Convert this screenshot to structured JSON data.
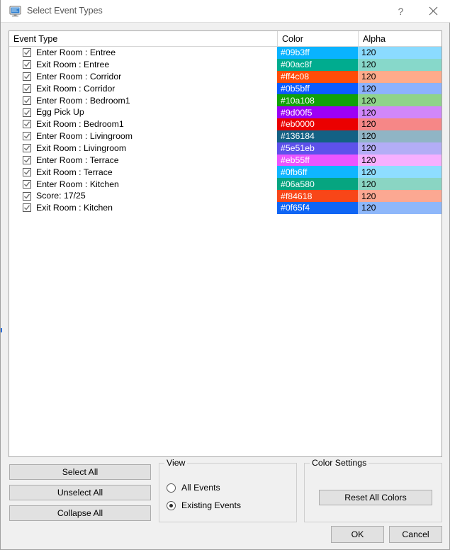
{
  "window": {
    "title": "Select Event Types",
    "icon": "monitor-icon",
    "help_label": "?",
    "close_label": "×"
  },
  "list": {
    "columns": [
      "Event Type",
      "Color",
      "Alpha"
    ],
    "rows": [
      {
        "label": "Enter Room : Entree",
        "checked": true,
        "color": "#09b3ff",
        "alpha": "120"
      },
      {
        "label": "Exit Room : Entree",
        "checked": true,
        "color": "#00ac8f",
        "alpha": "120"
      },
      {
        "label": "Enter Room : Corridor",
        "checked": true,
        "color": "#ff4c08",
        "alpha": "120"
      },
      {
        "label": "Exit Room : Corridor",
        "checked": true,
        "color": "#0b5bff",
        "alpha": "120"
      },
      {
        "label": "Enter Room : Bedroom1",
        "checked": true,
        "color": "#10a108",
        "alpha": "120"
      },
      {
        "label": "Egg Pick Up",
        "checked": true,
        "color": "#9d00f5",
        "alpha": "120"
      },
      {
        "label": "Exit Room : Bedroom1",
        "checked": true,
        "color": "#eb0000",
        "alpha": "120"
      },
      {
        "label": "Enter Room : Livingroom",
        "checked": true,
        "color": "#136184",
        "alpha": "120"
      },
      {
        "label": "Exit Room : Livingroom",
        "checked": true,
        "color": "#5e51eb",
        "alpha": "120"
      },
      {
        "label": "Enter Room : Terrace",
        "checked": true,
        "color": "#eb55ff",
        "alpha": "120"
      },
      {
        "label": "Exit Room : Terrace",
        "checked": true,
        "color": "#0fb6ff",
        "alpha": "120"
      },
      {
        "label": "Enter Room : Kitchen",
        "checked": true,
        "color": "#06a580",
        "alpha": "120"
      },
      {
        "label": "Score: 17/25",
        "checked": true,
        "color": "#f84618",
        "alpha": "120"
      },
      {
        "label": "Exit Room : Kitchen",
        "checked": true,
        "color": "#0f65f4",
        "alpha": "120"
      }
    ]
  },
  "actions": {
    "select_all": "Select All",
    "unselect_all": "Unselect All",
    "collapse_all": "Collapse All"
  },
  "view_group": {
    "legend": "View",
    "options": [
      {
        "label": "All Events",
        "selected": false
      },
      {
        "label": "Existing Events",
        "selected": true
      }
    ]
  },
  "color_settings": {
    "legend": "Color Settings",
    "reset_label": "Reset All Colors"
  },
  "dialog_buttons": {
    "ok": "OK",
    "cancel": "Cancel"
  }
}
